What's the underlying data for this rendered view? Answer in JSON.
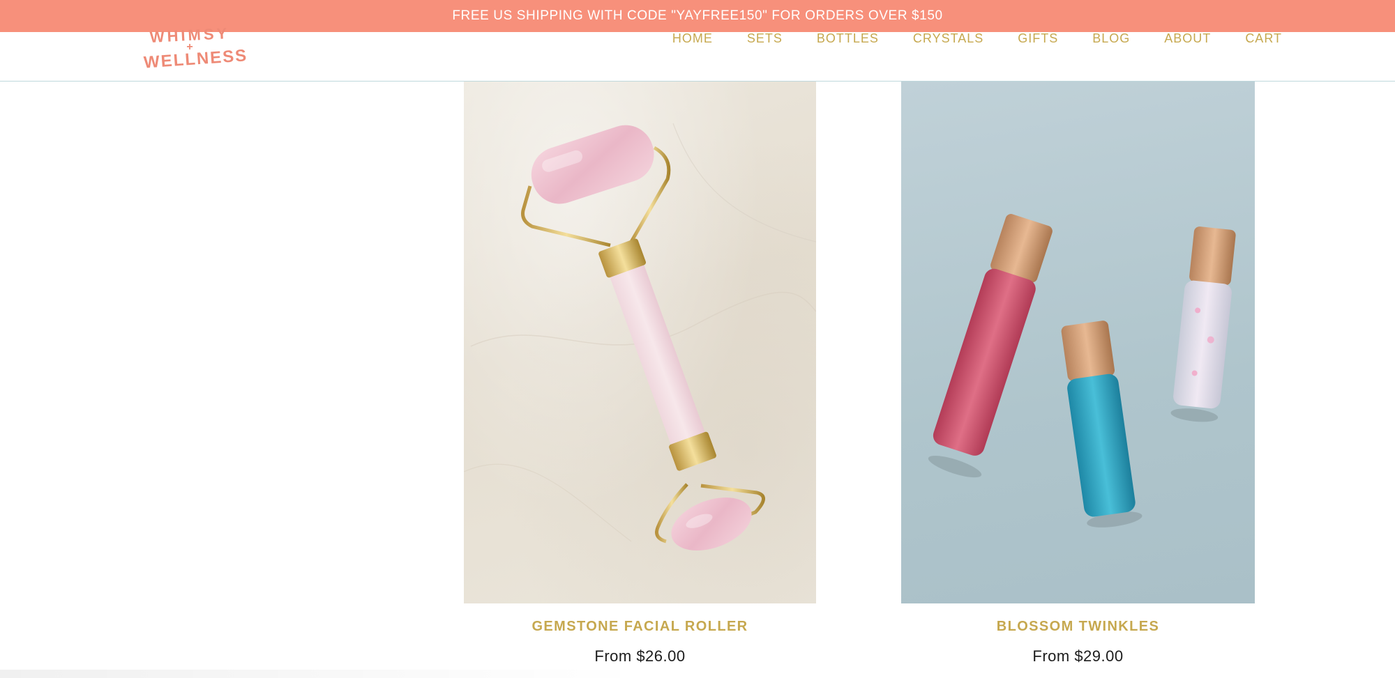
{
  "announcement": {
    "text": "FREE US SHIPPING WITH CODE \"YAYFREE150\" FOR ORDERS OVER $150"
  },
  "logo": {
    "line1": "WHIMSY",
    "plus": "+",
    "line2": "WELLNESS",
    "color": "#ee8a76"
  },
  "nav": {
    "items": [
      {
        "label": "HOME"
      },
      {
        "label": "SETS"
      },
      {
        "label": "BOTTLES"
      },
      {
        "label": "CRYSTALS"
      },
      {
        "label": "GIFTS"
      },
      {
        "label": "BLOG"
      },
      {
        "label": "ABOUT"
      },
      {
        "label": "CART"
      }
    ],
    "color": "#c6a84f"
  },
  "products": [
    {
      "title": "GEMSTONE FACIAL ROLLER",
      "price": "From $26.00"
    },
    {
      "title": "BLOSSOM TWINKLES",
      "price": "From $29.00"
    }
  ],
  "colors": {
    "banner": "#f7907b",
    "accent_gold": "#c6a84f"
  }
}
